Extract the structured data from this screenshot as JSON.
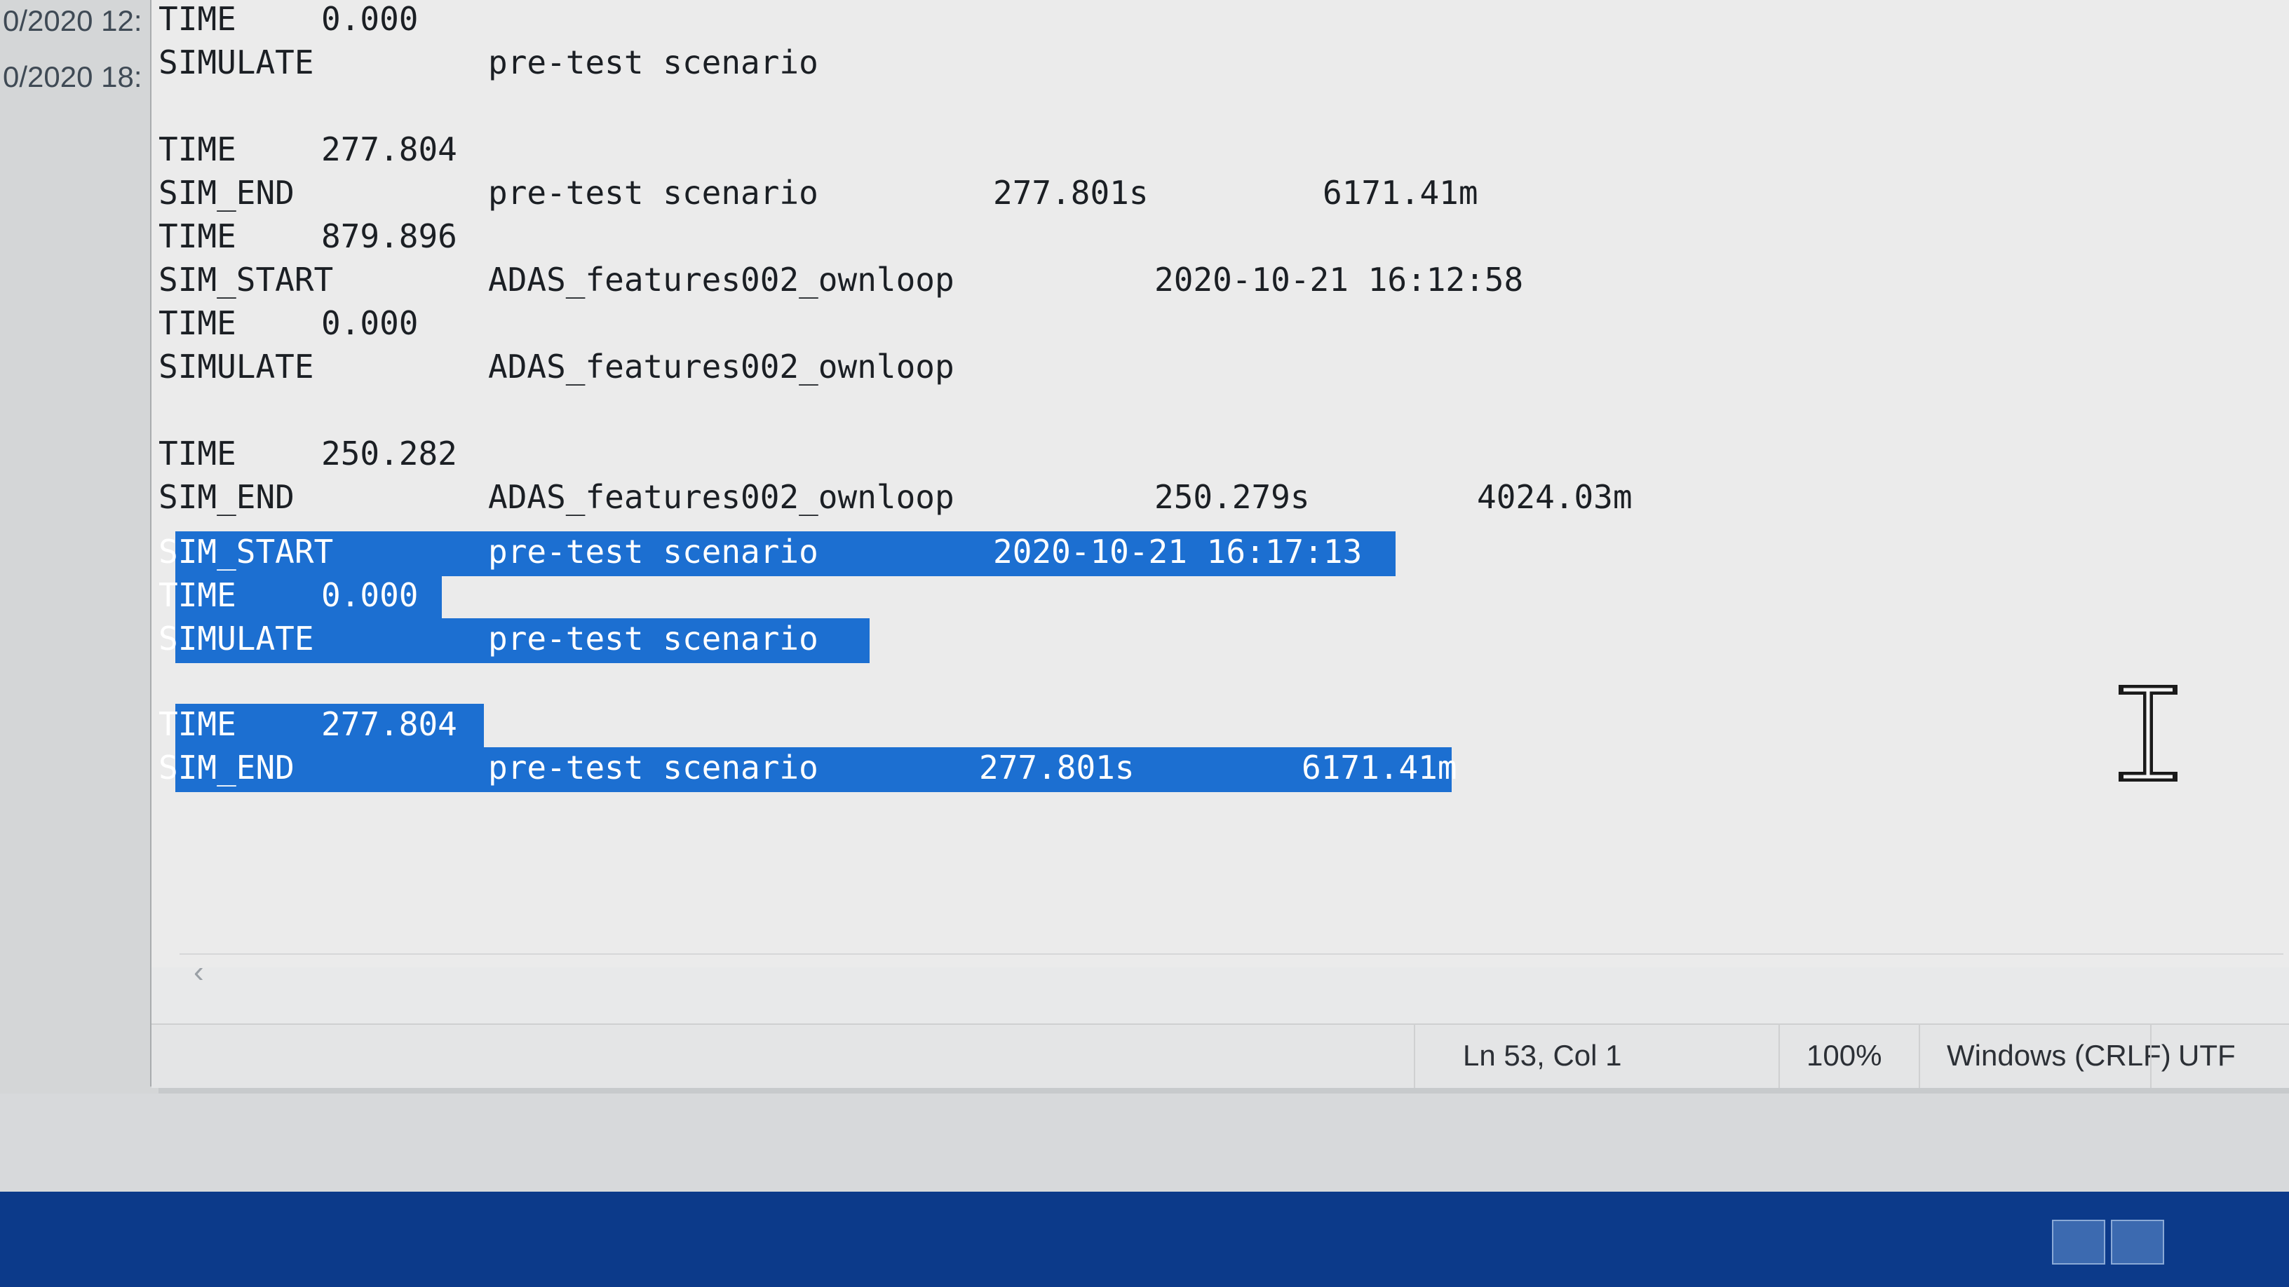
{
  "background_window": {
    "rows": [
      "0/2020 12:",
      "0/2020 18:"
    ]
  },
  "editor": {
    "lines": [
      {
        "col1": "TIME",
        "col2": "0.000",
        "col3": "",
        "col4": "",
        "col5": ""
      },
      {
        "col1": "SIMULATE",
        "col2": "",
        "col3": "pre-test scenario",
        "col4": "",
        "col5": ""
      },
      {
        "col1": "",
        "col2": "",
        "col3": "",
        "col4": "",
        "col5": ""
      },
      {
        "col1": "TIME",
        "col2": "277.804",
        "col3": "",
        "col4": "",
        "col5": ""
      },
      {
        "col1": "SIM_END",
        "col2": "",
        "col3": "pre-test scenario",
        "col4": "277.801s",
        "col5": "6171.41m"
      },
      {
        "col1": "TIME",
        "col2": "879.896",
        "col3": "",
        "col4": "",
        "col5": ""
      },
      {
        "col1": "SIM_START",
        "col2": "",
        "col3": "ADAS_features002_ownloop",
        "col4": "2020-10-21 16:12:58",
        "col5": ""
      },
      {
        "col1": "TIME",
        "col2": "0.000",
        "col3": "",
        "col4": "",
        "col5": ""
      },
      {
        "col1": "SIMULATE",
        "col2": "",
        "col3": "ADAS_features002_ownloop",
        "col4": "",
        "col5": ""
      },
      {
        "col1": "",
        "col2": "",
        "col3": "",
        "col4": "",
        "col5": ""
      },
      {
        "col1": "TIME",
        "col2": "250.282",
        "col3": "",
        "col4": "",
        "col5": ""
      },
      {
        "col1": "SIM_END",
        "col2": "",
        "col3": "ADAS_features002_ownloop",
        "col4": "250.279s",
        "col5": "4024.03m"
      },
      {
        "col1": "SIM_START",
        "col2": "",
        "col3": "pre-test scenario",
        "col4": "2020-10-21 16:17:13",
        "col5": ""
      },
      {
        "col1": "TIME",
        "col2": "0.000",
        "col3": "",
        "col4": "",
        "col5": ""
      },
      {
        "col1": "SIMULATE",
        "col2": "",
        "col3": "pre-test scenario",
        "col4": "",
        "col5": ""
      },
      {
        "col1": "",
        "col2": "",
        "col3": "",
        "col4": "",
        "col5": ""
      },
      {
        "col1": "TIME",
        "col2": "277.804",
        "col3": "",
        "col4": "",
        "col5": ""
      },
      {
        "col1": "SIM_END",
        "col2": "",
        "col3": "pre-test scenario",
        "col4": "277.801s",
        "col5": "6171.41m"
      }
    ]
  },
  "statusbar": {
    "position": "Ln 53, Col 1",
    "zoom": "100%",
    "line_endings": "Windows (CRLF)",
    "encoding": "UTF"
  },
  "colors": {
    "selection": "#1c6fd1",
    "editor_bg": "#ebebeb",
    "taskbar": "#0c3a8a"
  },
  "icons": {
    "cursor": "text-cursor-ibeam-icon",
    "scroll_left": "chevron-left-icon"
  }
}
